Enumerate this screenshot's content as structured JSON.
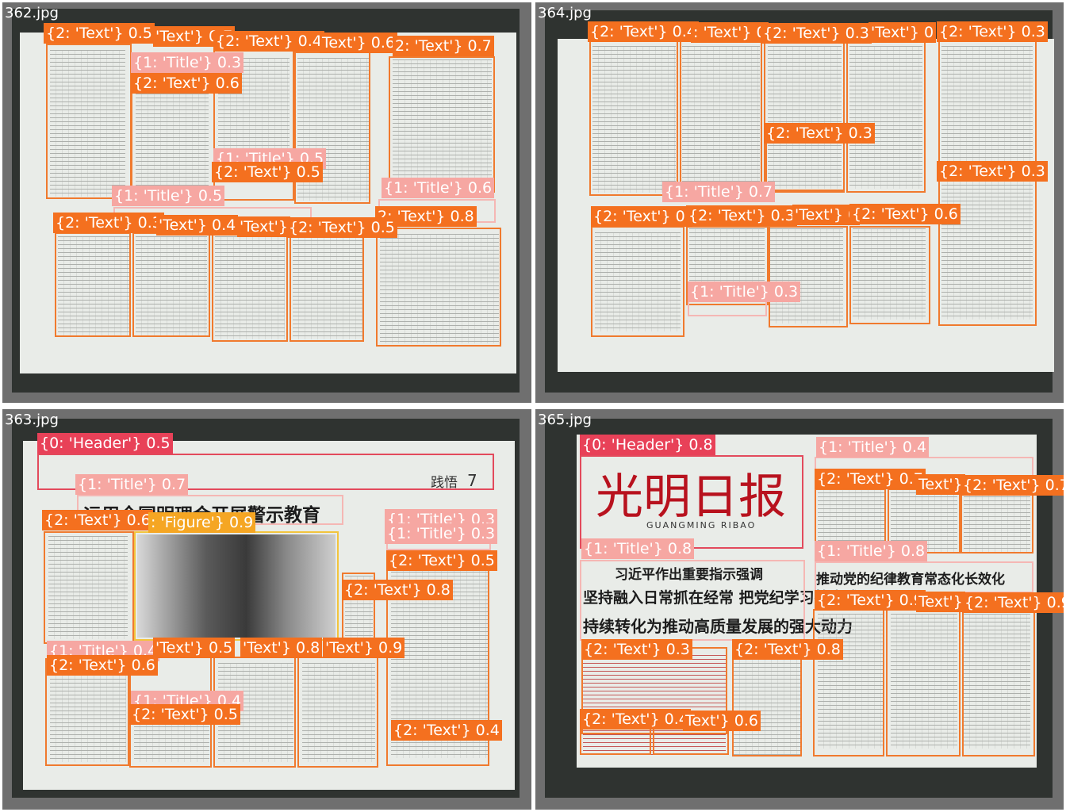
{
  "panels": {
    "p362": {
      "filename": "362.jpg",
      "labels": [
        "{2: 'Text'} 0.5",
        "'Text'} 0.7",
        "{2: 'Text'} 0.4",
        "Text'} 0.6",
        "2: 'Text'} 0.7",
        "{1: 'Title'} 0.3",
        "{2: 'Text'} 0.6",
        "{1: 'Title'} 0.5",
        "{2: 'Text'} 0.5",
        "{1: 'Title'} 0.6",
        "{1: 'Title'} 0.5",
        "2: 'Text'} 0.8",
        "{2: 'Text'} 0.3",
        "'Text'} 0.4",
        "'Text'}",
        "{2: 'Text'} 0.5"
      ]
    },
    "p364": {
      "filename": "364.jpg",
      "labels": [
        "{2: 'Text'} 0.4",
        ": 'Text'} 0",
        "{2: 'Text'} 0.3",
        "'Text'} 0",
        "{2: 'Text'} 0.3",
        "{2: 'Text'} 0.3",
        "{2: 'Text'} 0.3",
        "{1: 'Title'} 0.7",
        "{2: 'Text'} 0.",
        "{2: 'Text'} 0.3",
        "'Text'} 0",
        "{2: 'Text'} 0.6",
        "{1: 'Title'} 0.3"
      ]
    },
    "p363": {
      "filename": "363.jpg",
      "header_text": "践悟",
      "page_number": "7",
      "title_text": "运用全国明理会开展警示教育",
      "labels": [
        "{0: 'Header'} 0.5",
        "{1: 'Title'} 0.7",
        "{2: 'Text'} 0.6",
        ": 'Figure'} 0.9",
        "{1: 'Title'} 0.3",
        "{1: 'Title'} 0.3",
        "{2: 'Text'} 0.5",
        "{2: 'Text'} 0.8",
        "{1: 'Title'} 0.4",
        "'Text'} 0.5",
        "'Text'} 0.8",
        "'Text'} 0.9",
        "{1: 'Title'} 0.4",
        "{2: 'Text'} 0.4",
        "{2: 'Text'} 0.6",
        "{2: 'Text'} 0.5"
      ]
    },
    "p365": {
      "filename": "365.jpg",
      "masthead": "光明日报",
      "masthead_latin": "GUANGMING RIBAO",
      "headline_small": "习近平作出重要指示强调",
      "headline_line1": "坚持融入日常抓在经常 把党纪学习教育成果",
      "headline_line2": "持续转化为推动高质量发展的强大动力",
      "side_title": "推动党的纪律教育常态化长效化",
      "labels": [
        "{0: 'Header'} 0.8",
        "{1: 'Title'} 0.4",
        "{2: 'Text'} 0.7",
        "Text'}",
        "{2: 'Text'} 0.7",
        "{1: 'Title'} 0.8",
        "{1: 'Title'} 0.8",
        "{2: 'Text'} 0.9",
        "Text'}",
        "{2: 'Text'} 0.9",
        "{2: 'Text'} 0.3",
        "{2: 'Text'} 0.8",
        "{2: 'Text'} 0.4",
        "Text'} 0.6"
      ]
    }
  },
  "colors": {
    "text_box": "#f07a2e",
    "title_box": "#f5b7b4",
    "header_box": "#e34a5c",
    "figure_box": "#f2c43d",
    "panel_bg": "#6f6f6f"
  }
}
